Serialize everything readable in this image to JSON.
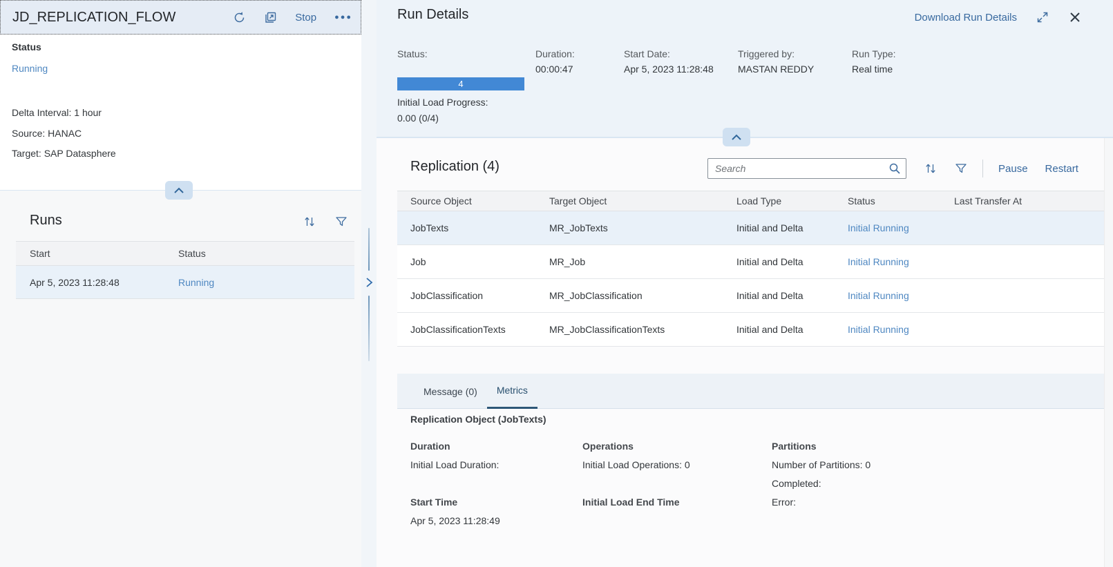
{
  "colors": {
    "link": "#38699f",
    "status-link": "#4e87c1",
    "progress": "#4288d5",
    "tab-underline": "#2d5777"
  },
  "left_panel": {
    "title": "JD_REPLICATION_FLOW",
    "stop_label": "Stop",
    "status_heading": "Status",
    "status_value": "Running",
    "delta_interval": "Delta Interval: 1 hour",
    "source": "Source: HANAC",
    "target": "Target: SAP Datasphere",
    "runs": {
      "title": "Runs",
      "col_start": "Start",
      "col_status": "Status",
      "row": {
        "start": "Apr 5, 2023 11:28:48",
        "status": "Running"
      }
    }
  },
  "run_details": {
    "title": "Run Details",
    "download_label": "Download Run Details",
    "status_label": "Status:",
    "duration_label": "Duration:",
    "duration_value": "00:00:47",
    "start_date_label": "Start Date:",
    "start_date_value": "Apr 5, 2023 11:28:48",
    "triggered_by_label": "Triggered by:",
    "triggered_by_value": "MASTAN REDDY",
    "run_type_label": "Run Type:",
    "run_type_value": "Real time",
    "progress_value": "4",
    "initial_load_progress_label": "Initial Load Progress:",
    "initial_load_progress_value": "0.00 (0/4)"
  },
  "replication": {
    "title": "Replication (4)",
    "search_placeholder": "Search",
    "pause_label": "Pause",
    "restart_label": "Restart",
    "col_source": "Source Object",
    "col_target": "Target Object",
    "col_load_type": "Load Type",
    "col_status": "Status",
    "col_last_transfer": "Last Transfer At",
    "rows": [
      {
        "source": "JobTexts",
        "target": "MR_JobTexts",
        "load_type": "Initial and Delta",
        "status": "Initial Running",
        "last_transfer_at": ""
      },
      {
        "source": "Job",
        "target": "MR_Job",
        "load_type": "Initial and Delta",
        "status": "Initial Running",
        "last_transfer_at": ""
      },
      {
        "source": "JobClassification",
        "target": "MR_JobClassification",
        "load_type": "Initial and Delta",
        "status": "Initial Running",
        "last_transfer_at": ""
      },
      {
        "source": "JobClassificationTexts",
        "target": "MR_JobClassificationTexts",
        "load_type": "Initial and Delta",
        "status": "Initial Running",
        "last_transfer_at": ""
      }
    ]
  },
  "tabs": {
    "message": "Message (0)",
    "metrics": "Metrics"
  },
  "metrics": {
    "heading": "Replication Object (JobTexts)",
    "col1_title": "Duration",
    "col1_line1": "Initial Load Duration:",
    "col1_sub_title": "Start Time",
    "col1_sub_value": "Apr 5, 2023 11:28:49",
    "col2_title": "Operations",
    "col2_line1": "Initial Load Operations: 0",
    "col2_sub_title": "Initial Load End Time",
    "col3_title": "Partitions",
    "col3_line1": "Number of Partitions: 0",
    "col3_line2": "Completed:",
    "col3_line3": "Error:"
  }
}
